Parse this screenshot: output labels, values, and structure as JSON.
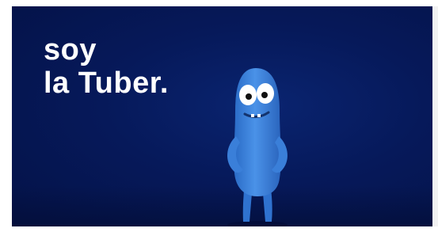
{
  "video": {
    "caption_line1": "soy",
    "caption_line2": "la Tuber."
  },
  "colors": {
    "background": "#06195a",
    "caption": "#ffffff",
    "mascot_body": "#3f86e0"
  },
  "mascot": {
    "icon": "blue-tuber-character"
  }
}
